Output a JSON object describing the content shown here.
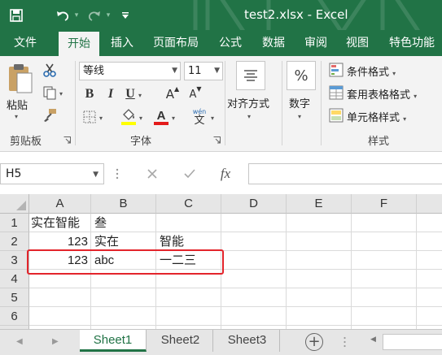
{
  "window": {
    "title": "test2.xlsx  -  Excel"
  },
  "tabs": [
    "文件",
    "开始",
    "插入",
    "页面布局",
    "公式",
    "数据",
    "审阅",
    "视图",
    "特色功能"
  ],
  "active_tab": "开始",
  "ribbon": {
    "clipboard": {
      "paste_label": "粘贴",
      "group_label": "剪贴板"
    },
    "font": {
      "font_name": "等线",
      "font_size": "11",
      "group_label": "字体",
      "grow_label": "A",
      "shrink_label": "A",
      "wen_label": "文",
      "wen_top": "wén"
    },
    "alignment": {
      "label": "对齐方式"
    },
    "number": {
      "label": "数字",
      "symbol": "%"
    },
    "styles": {
      "conditional": "条件格式",
      "table": "套用表格格式",
      "cell_styles": "单元格样式",
      "group_label": "样式"
    },
    "accent_color": "#217346"
  },
  "formula_bar": {
    "name_box": "H5",
    "fx": "fx",
    "value": ""
  },
  "grid": {
    "columns": [
      "A",
      "B",
      "C",
      "D",
      "E",
      "F"
    ],
    "rows": [
      "1",
      "2",
      "3",
      "4",
      "5",
      "6"
    ],
    "cells": {
      "A1": "实在智能",
      "B1": "叁",
      "A2": "123",
      "B2": "实在",
      "C2": "智能",
      "A3": "123",
      "B3": "abc",
      "C3": "一二三"
    },
    "highlight_color": "#e3242b"
  },
  "sheets": [
    "Sheet1",
    "Sheet2",
    "Sheet3"
  ],
  "active_sheet": "Sheet1",
  "add_sheet_label": "+"
}
